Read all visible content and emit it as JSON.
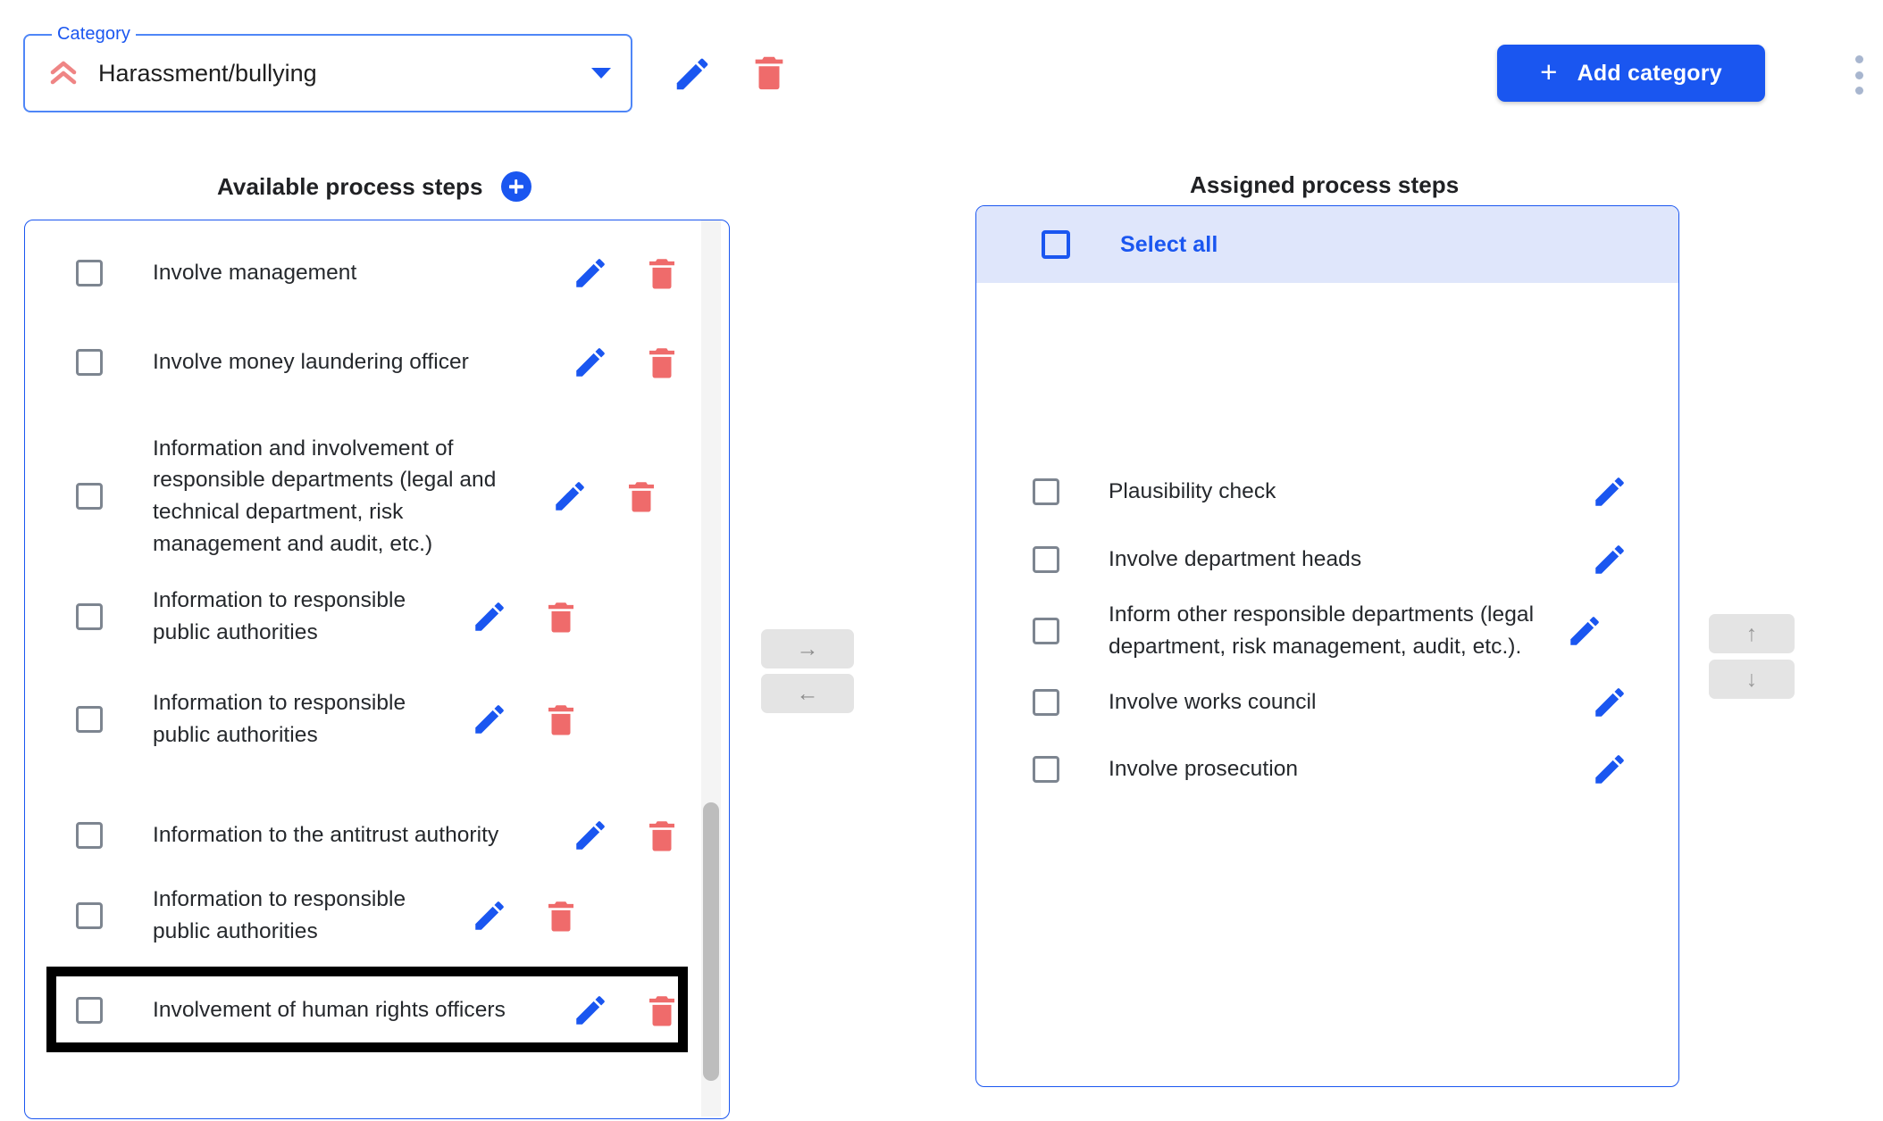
{
  "topbar": {
    "category_legend": "Category",
    "category_value": "Harassment/bullying",
    "category_icon": "double-chevron-up-icon",
    "dropdown_icon": "chevron-down-icon",
    "edit_icon": "pencil-icon",
    "delete_icon": "trash-icon",
    "add_category_label": "Add category",
    "add_category_plus": "+",
    "kebab_icon": "more-vertical-icon",
    "accent_blue": "#1a56f0",
    "danger_red": "#ef6b6b"
  },
  "available": {
    "heading": "Available process steps",
    "add_icon": "plus-circle-icon",
    "items": [
      {
        "label": "Involve management"
      },
      {
        "label": "Involve money laundering officer"
      },
      {
        "label": "Information and involvement of responsible departments (legal and technical department, risk management and audit, etc.)"
      },
      {
        "label": "Information to responsible public authorities"
      },
      {
        "label": "Information to responsible public authorities"
      },
      {
        "label": "Information to the antitrust authority"
      },
      {
        "label": "Information to responsible public authorities"
      },
      {
        "label": "Involvement of human rights officers",
        "highlighted": true
      }
    ]
  },
  "transfer": {
    "to_right_label": "→",
    "to_left_label": "←"
  },
  "reorder": {
    "up_label": "↑",
    "down_label": "↓"
  },
  "assigned": {
    "heading": "Assigned process steps",
    "select_all_label": "Select all",
    "items": [
      {
        "label": "Plausibility check"
      },
      {
        "label": "Involve department heads"
      },
      {
        "label": "Inform other responsible departments (legal department, risk management, audit, etc.)."
      },
      {
        "label": "Involve works council"
      },
      {
        "label": "Involve prosecution"
      }
    ]
  }
}
